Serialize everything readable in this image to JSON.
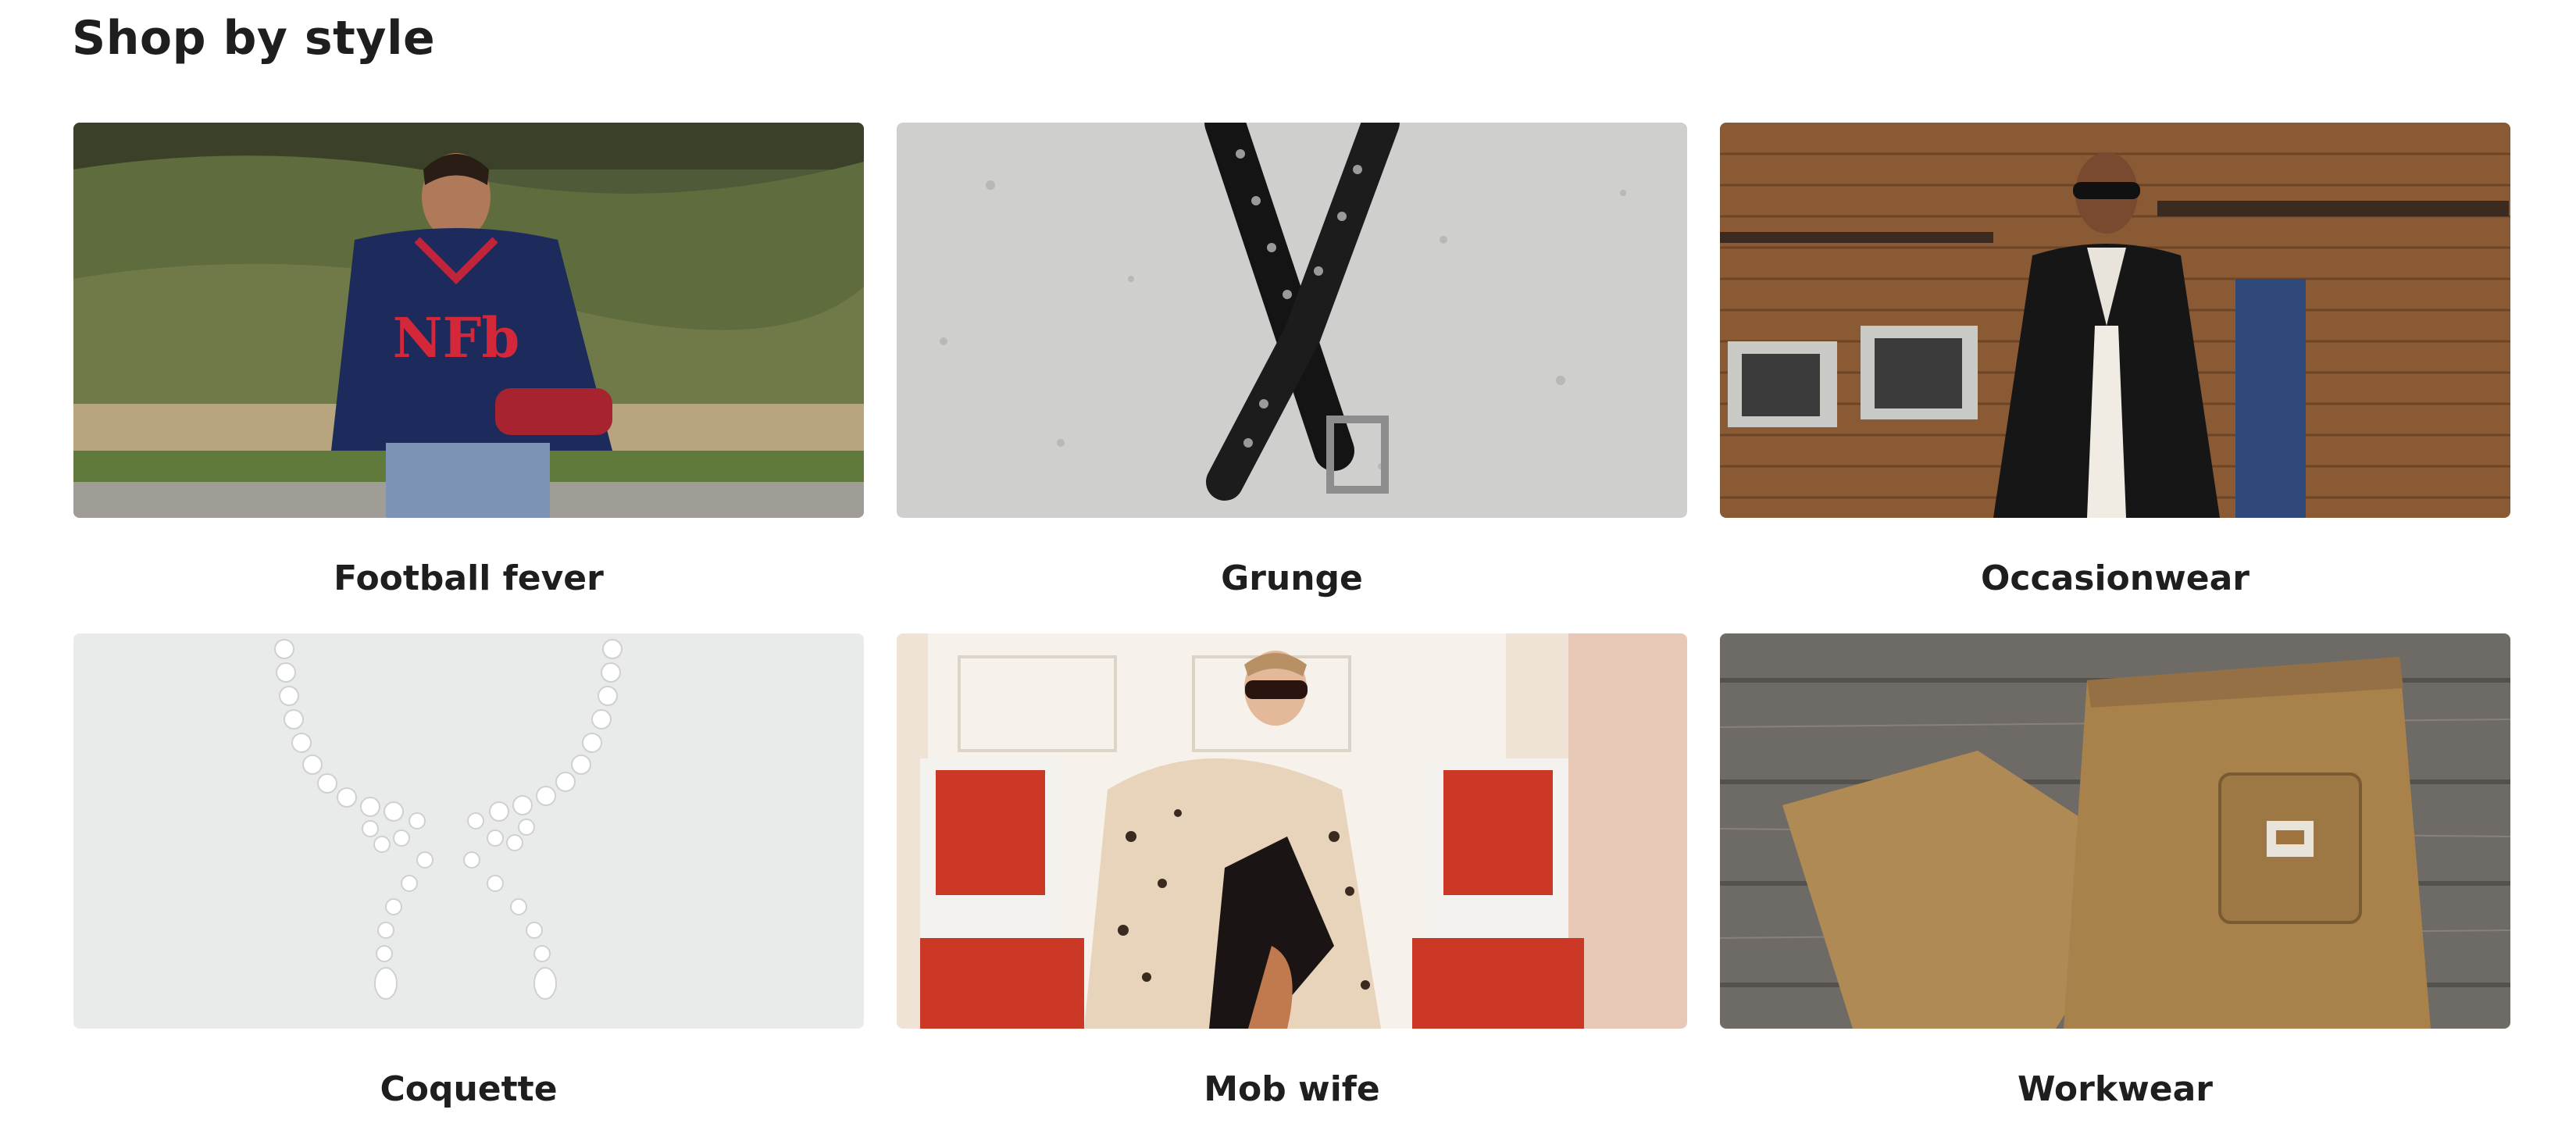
{
  "section": {
    "title": "Shop by style"
  },
  "styles": [
    {
      "label": "Football fever",
      "image": "woman-in-navy-nfl-jersey-photo"
    },
    {
      "label": "Grunge",
      "image": "studded-black-belt-photo"
    },
    {
      "label": "Occasionwear",
      "image": "man-in-black-suit-photo"
    },
    {
      "label": "Coquette",
      "image": "pearl-bow-necklace-photo"
    },
    {
      "label": "Mob wife",
      "image": "woman-in-leopard-fur-coat-photo"
    },
    {
      "label": "Workwear",
      "image": "tan-carhartt-work-pants-photo"
    }
  ]
}
